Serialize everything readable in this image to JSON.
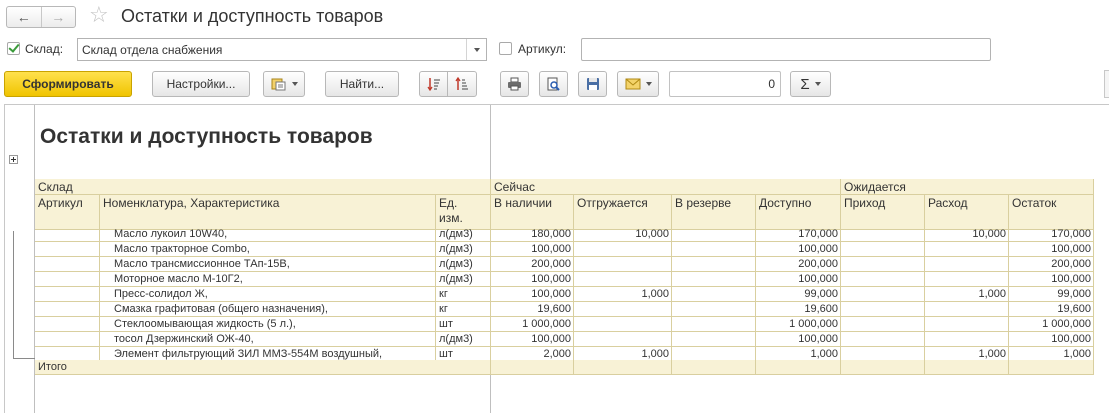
{
  "title_bar": {
    "back_glyph": "←",
    "forward_glyph": "→",
    "star_glyph": "☆",
    "title": "Остатки и доступность товаров"
  },
  "filters": {
    "warehouse_checked": true,
    "warehouse_label": "Склад:",
    "warehouse_value": "Склад отдела снабжения",
    "article_checked": false,
    "article_label": "Артикул:",
    "article_value": ""
  },
  "toolbar": {
    "generate_label": "Сформировать",
    "settings_label": "Настройки...",
    "find_label": "Найти...",
    "number_value": "0",
    "sum_glyph": "Σ"
  },
  "report": {
    "title": "Остатки и доступность товаров",
    "header": {
      "warehouse": "Склад",
      "now": "Сейчас",
      "expected": "Ожидается",
      "article": "Артикул",
      "item": "Номенклатура, Характеристика",
      "unit": "Ед. изм.",
      "in_stock": "В наличии",
      "shipping": "Отгружается",
      "reserved": "В резерве",
      "available": "Доступно",
      "income": "Приход",
      "outgo": "Расход",
      "remainder": "Остаток"
    },
    "rows": [
      {
        "name": "Масло лукоил 10W40,",
        "unit": "л(дм3)",
        "stock": "180,000",
        "ship": "10,000",
        "res": "",
        "avail": "170,000",
        "inc": "",
        "out": "10,000",
        "rest": "170,000"
      },
      {
        "name": "Масло тракторное Combo,",
        "unit": "л(дм3)",
        "stock": "100,000",
        "ship": "",
        "res": "",
        "avail": "100,000",
        "inc": "",
        "out": "",
        "rest": "100,000"
      },
      {
        "name": "Масло трансмиссионное ТАп-15В,",
        "unit": "л(дм3)",
        "stock": "200,000",
        "ship": "",
        "res": "",
        "avail": "200,000",
        "inc": "",
        "out": "",
        "rest": "200,000"
      },
      {
        "name": "Моторное масло М-10Г2,",
        "unit": "л(дм3)",
        "stock": "100,000",
        "ship": "",
        "res": "",
        "avail": "100,000",
        "inc": "",
        "out": "",
        "rest": "100,000"
      },
      {
        "name": "Пресс-солидол Ж,",
        "unit": "кг",
        "stock": "100,000",
        "ship": "1,000",
        "res": "",
        "avail": "99,000",
        "inc": "",
        "out": "1,000",
        "rest": "99,000"
      },
      {
        "name": "Смазка графитовая (общего назначения),",
        "unit": "кг",
        "stock": "19,600",
        "ship": "",
        "res": "",
        "avail": "19,600",
        "inc": "",
        "out": "",
        "rest": "19,600"
      },
      {
        "name": "Стеклоомывающая жидкость (5 л.),",
        "unit": "шт",
        "stock": "1 000,000",
        "ship": "",
        "res": "",
        "avail": "1 000,000",
        "inc": "",
        "out": "",
        "rest": "1 000,000"
      },
      {
        "name": "тосол Дзержинский ОЖ-40,",
        "unit": "л(дм3)",
        "stock": "100,000",
        "ship": "",
        "res": "",
        "avail": "100,000",
        "inc": "",
        "out": "",
        "rest": "100,000"
      },
      {
        "name": "Элемент фильтрующий ЗИЛ ММЗ-554М воздушный,",
        "unit": "шт",
        "stock": "2,000",
        "ship": "1,000",
        "res": "",
        "avail": "1,000",
        "inc": "",
        "out": "1,000",
        "rest": "1,000"
      }
    ],
    "total_label": "Итого"
  }
}
